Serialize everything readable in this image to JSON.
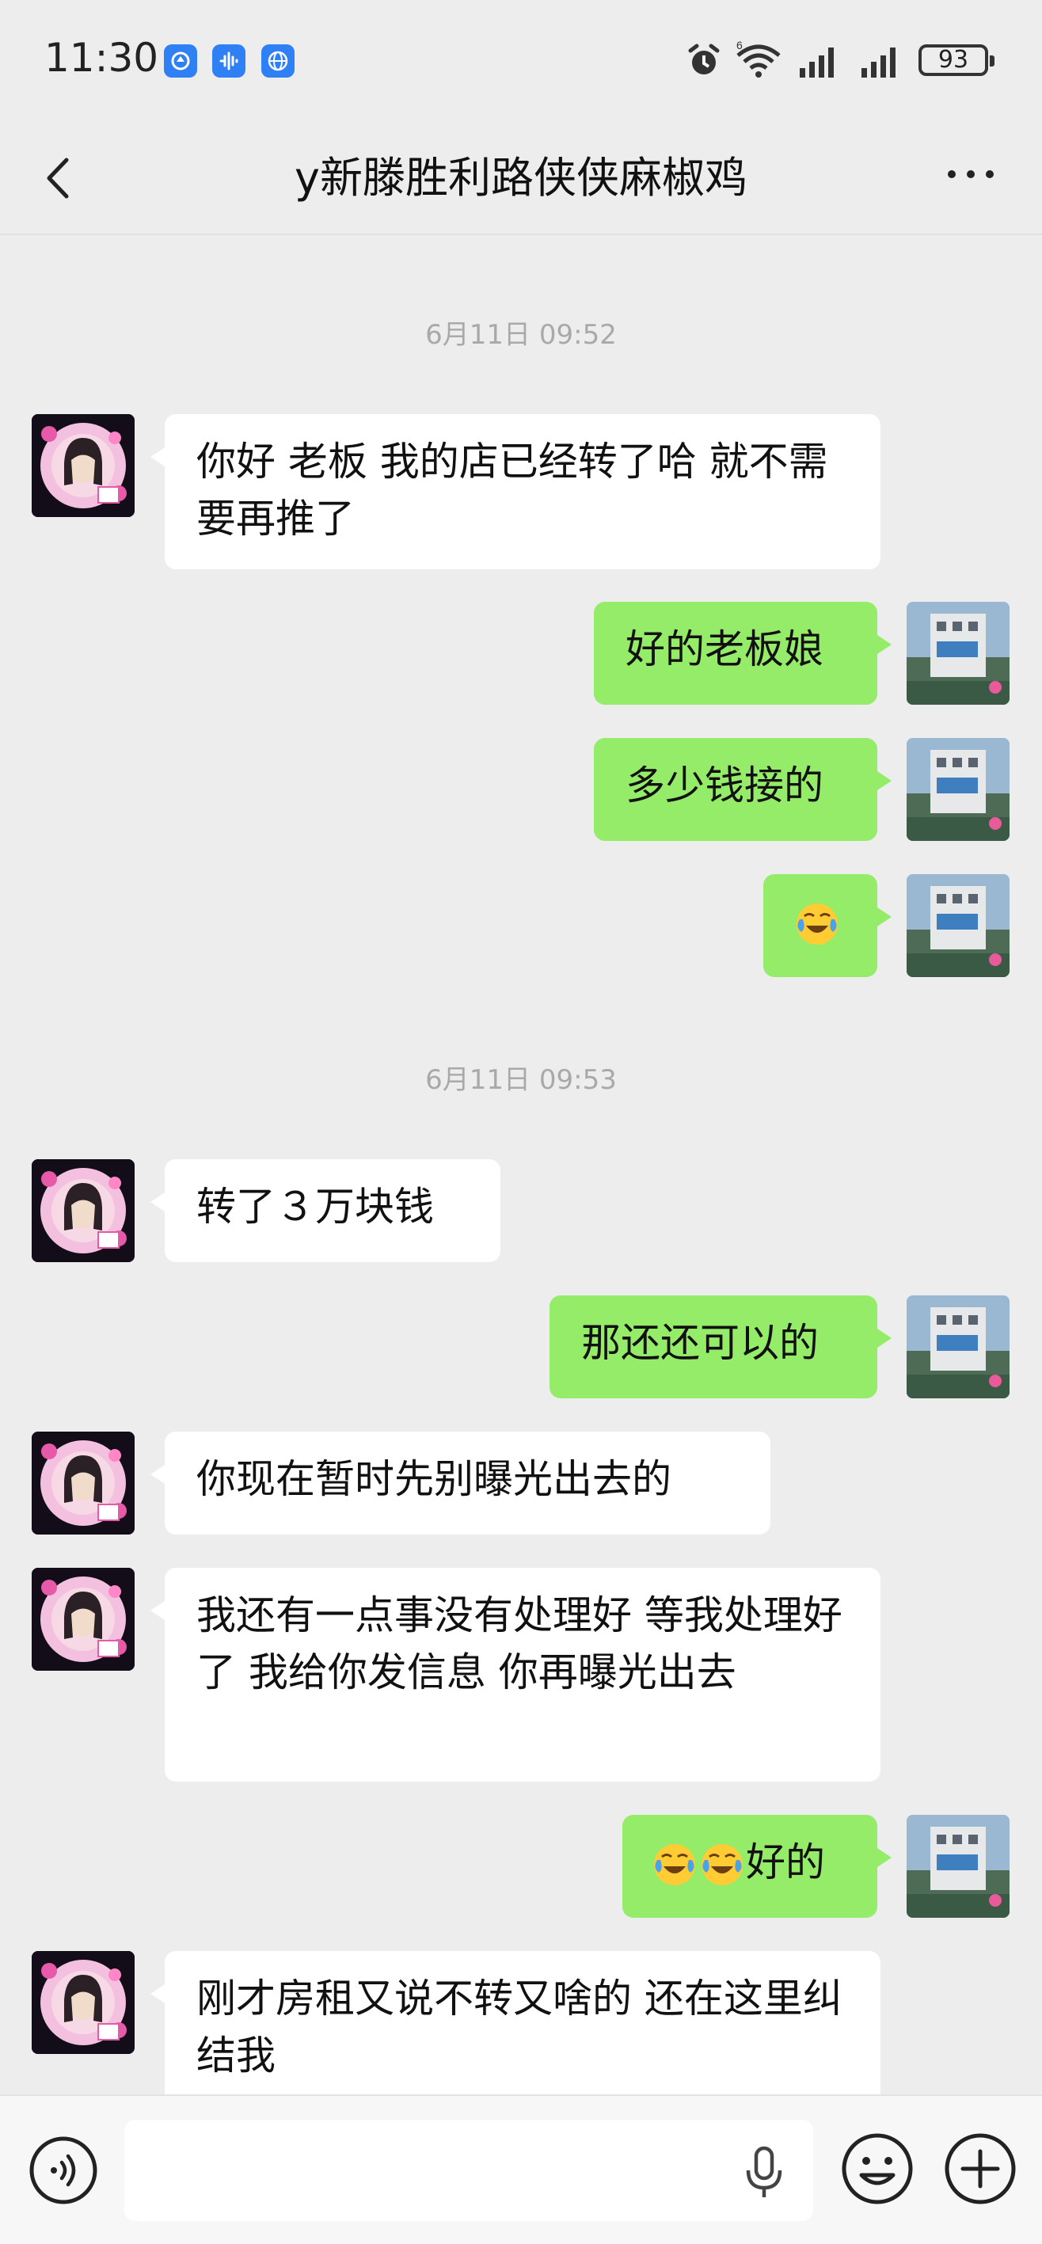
{
  "status_bar": {
    "time": "11:30",
    "battery": "93"
  },
  "header": {
    "title": "y新滕胜利路侠侠麻椒鸡"
  },
  "messages": [
    {
      "type": "timestamp",
      "text": "6月11日 09:52"
    },
    {
      "type": "msg",
      "side": "left",
      "text": "你好 老板 我的店已经转了哈 就不需要再推了"
    },
    {
      "type": "msg",
      "side": "right",
      "text": "好的老板娘"
    },
    {
      "type": "msg",
      "side": "right",
      "text": "多少钱接的"
    },
    {
      "type": "msg",
      "side": "right",
      "emoji_count": 1,
      "text": ""
    },
    {
      "type": "timestamp",
      "text": "6月11日 09:53"
    },
    {
      "type": "msg",
      "side": "left",
      "text": "转了３万块钱"
    },
    {
      "type": "msg",
      "side": "right",
      "text": "那还还可以的"
    },
    {
      "type": "msg",
      "side": "left",
      "text": "你现在暂时先别曝光出去的"
    },
    {
      "type": "msg",
      "side": "left",
      "text": "我还有一点事没有处理好 等我处理好了 我给你发信息 你再曝光出去"
    },
    {
      "type": "msg",
      "side": "right",
      "emoji_count": 2,
      "text": "好的"
    },
    {
      "type": "msg",
      "side": "left",
      "text": "刚才房租又说不转又啥的 还在这里纠结我"
    }
  ],
  "icons": {
    "back": "chevron-left-icon",
    "more": "more-dots-icon",
    "voice_toggle": "voice-mode-icon",
    "mic": "microphone-icon",
    "emoji": "emoji-smile-icon",
    "plus": "plus-circle-icon",
    "emoji_inline": "laugh-cry-emoji-icon"
  },
  "colors": {
    "background": "#ededed",
    "bubble_sent": "#95ec69",
    "bubble_received": "#ffffff",
    "timestamp": "#a9a9a9"
  }
}
